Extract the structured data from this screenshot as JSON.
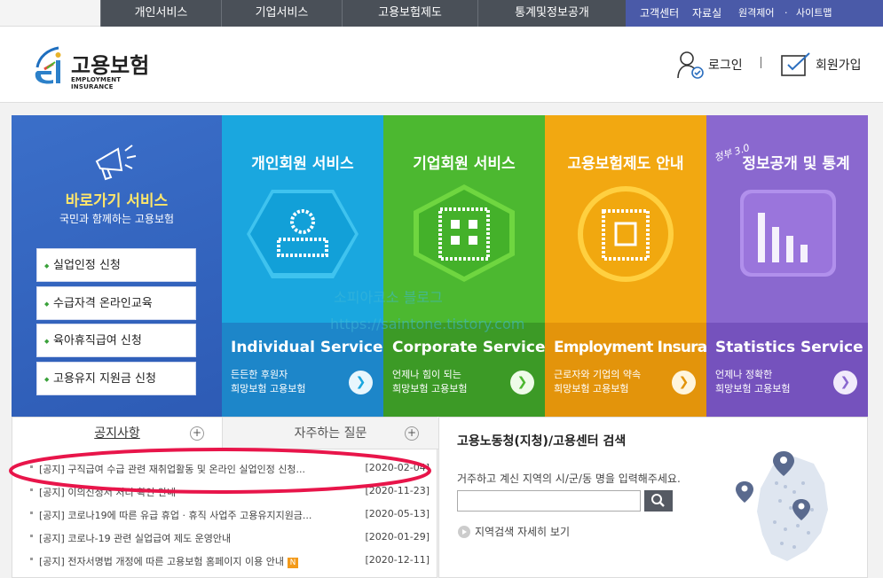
{
  "topnav": {
    "items": [
      "개인서비스",
      "기업서비스",
      "고용보험제도",
      "통계및정보공개"
    ],
    "util": {
      "customer_center": "고객센터",
      "library": "자료실",
      "viewer": "원격제어",
      "sitemap": "사이트맵",
      "dot": "·"
    }
  },
  "header": {
    "logo_ko": "고용보험",
    "logo_en": "EMPLOYMENT INSURANCE",
    "login": "로그인",
    "join": "회원가입"
  },
  "quick": {
    "title": "바로가기 서비스",
    "subtitle": "국민과 함께하는 고용보험",
    "links": [
      "실업인정 신청",
      "수급자격 온라인교육",
      "육아휴직급여 신청",
      "고용유지 지원금 신청"
    ]
  },
  "cards": [
    {
      "title": "개인회원 서비스",
      "en": "Individual Service",
      "d1": "든든한 후원자",
      "d2": "희망보험 고용보험",
      "color": "#1aa7df"
    },
    {
      "title": "기업회원 서비스",
      "en": "Corporate Service",
      "d1": "언제나 힘이 되는",
      "d2": "희망보험 고용보험",
      "color": "#4cb830"
    },
    {
      "title": "고용보험제도 안내",
      "en": "Employment Insurance",
      "d1": "근로자와 기업의 약속",
      "d2": "희망보험 고용보험",
      "color": "#f2a811"
    },
    {
      "title": "정보공개 및 통계",
      "badge": "정부 3.0",
      "en": "Statistics Service",
      "d1": "언제나 정확한",
      "d2": "희망보험 고용보험",
      "color": "#8a68cf"
    }
  ],
  "notice": {
    "tabs": [
      "공지사항",
      "자주하는 질문"
    ],
    "rows": [
      {
        "title": "[공지] 구직급여 수급 관련 재취업활동 및 온라인 실업인정 신청...",
        "date": "[2020-02-04]"
      },
      {
        "title": "[공지] 이의신청서 처리 확인 안내",
        "date": "[2020-11-23]"
      },
      {
        "title": "[공지] 코로나19에 따른 유급 휴업 · 휴직 사업주 고용유지지원금...",
        "date": "[2020-05-13]"
      },
      {
        "title": "[공지] 코로나-19 관련 실업급여 제도 운영안내",
        "date": "[2020-01-29]"
      },
      {
        "title": "[공지] 전자서명법 개정에 따른 고용보험 홈페이지 이용 안내",
        "date": "[2020-12-11]",
        "badge": "N"
      }
    ]
  },
  "search": {
    "title": "고용노동청(지청)/고용센터 검색",
    "help": "거주하고 계신 지역의 시/군/동 명을 입력해주세요.",
    "value": "",
    "more": "지역검색 자세히 보기"
  },
  "watermark": {
    "line1": "소피아코소 블로그",
    "line2": "https://saintone.tistory.com"
  }
}
